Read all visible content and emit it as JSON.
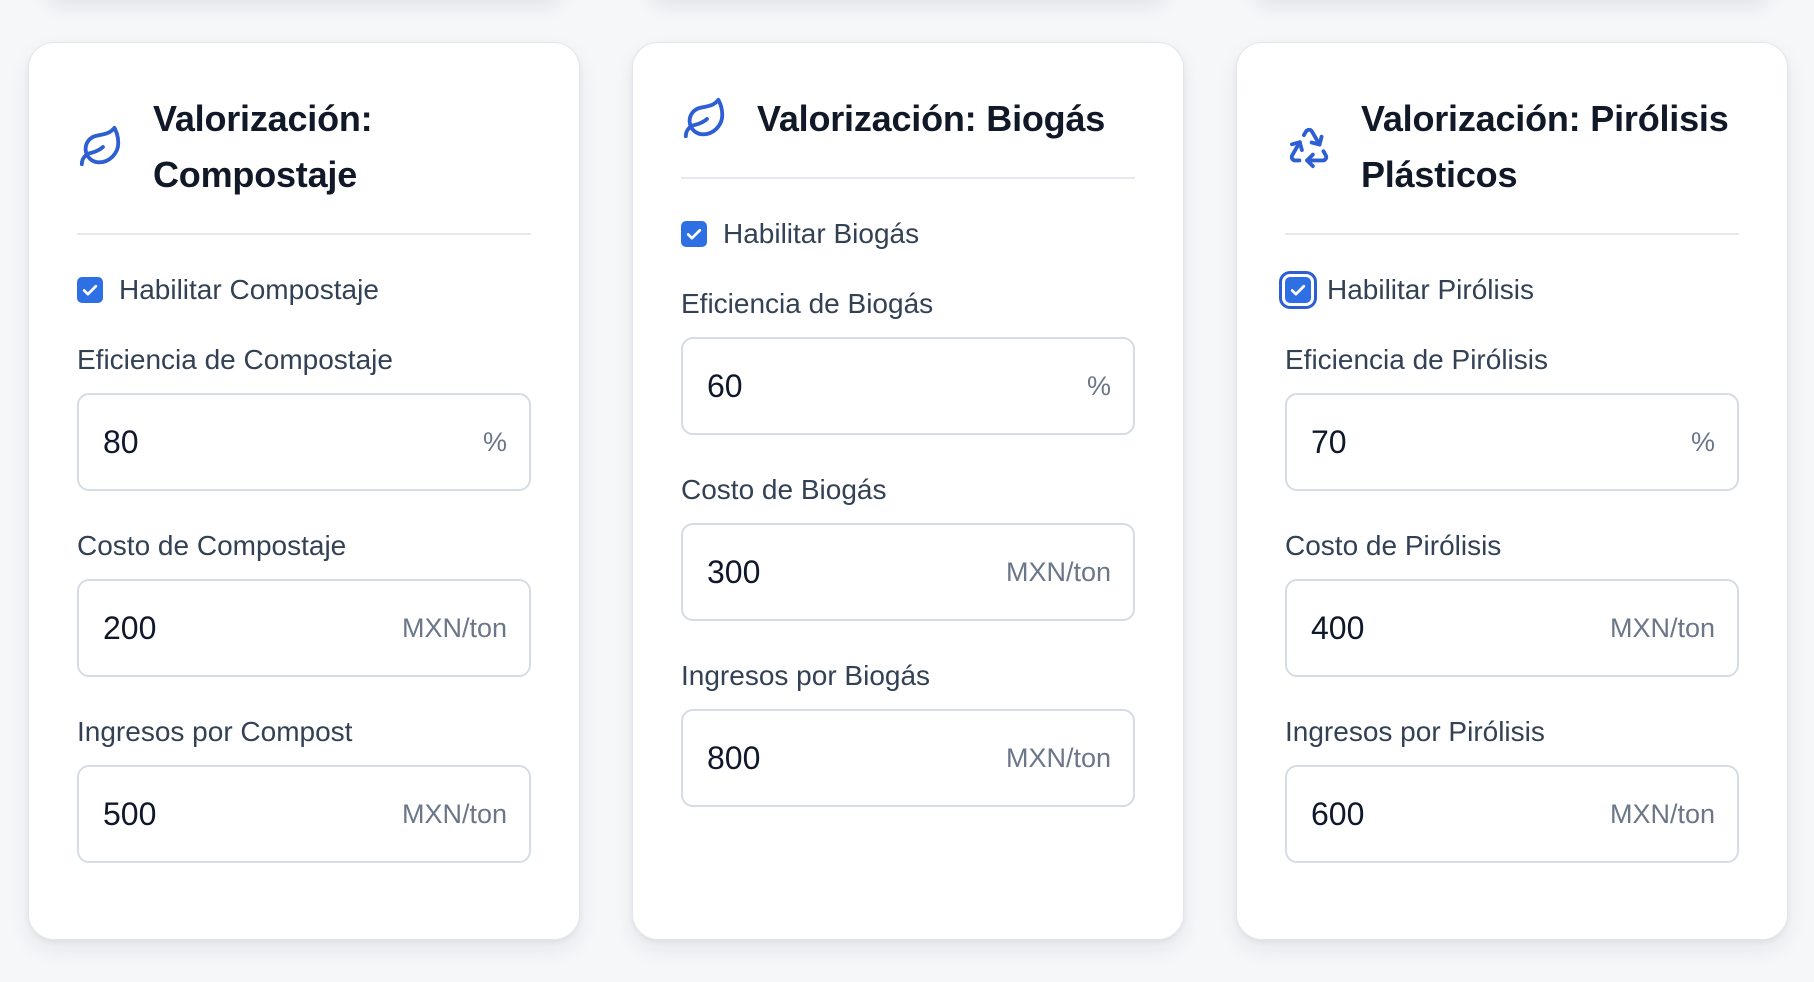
{
  "colors": {
    "accent": "#2f6fe4",
    "icon": "#2d5fd3",
    "title": "#111827",
    "label": "#334155",
    "unit": "#6b7789",
    "border": "#d6dce5",
    "background": "#f6f7f9"
  },
  "cards": [
    {
      "icon": "leaf-icon",
      "title": "Valorización: Compostaje",
      "enable_label": "Habilitar Compostaje",
      "enabled": true,
      "fields": [
        {
          "label": "Eficiencia de Compostaje",
          "value": "80",
          "unit": "%"
        },
        {
          "label": "Costo de Compostaje",
          "value": "200",
          "unit": "MXN/ton"
        },
        {
          "label": "Ingresos por Compost",
          "value": "500",
          "unit": "MXN/ton"
        }
      ]
    },
    {
      "icon": "leaf-icon",
      "title": "Valorización: Biogás",
      "enable_label": "Habilitar Biogás",
      "enabled": true,
      "fields": [
        {
          "label": "Eficiencia de Biogás",
          "value": "60",
          "unit": "%"
        },
        {
          "label": "Costo de Biogás",
          "value": "300",
          "unit": "MXN/ton"
        },
        {
          "label": "Ingresos por Biogás",
          "value": "800",
          "unit": "MXN/ton"
        }
      ]
    },
    {
      "icon": "recycle-icon",
      "title": "Valorización: Pirólisis Plásticos",
      "enable_label": "Habilitar Pirólisis",
      "enabled": true,
      "fields": [
        {
          "label": "Eficiencia de Pirólisis",
          "value": "70",
          "unit": "%"
        },
        {
          "label": "Costo de Pirólisis",
          "value": "400",
          "unit": "MXN/ton"
        },
        {
          "label": "Ingresos por Pirólisis",
          "value": "600",
          "unit": "MXN/ton"
        }
      ]
    }
  ]
}
